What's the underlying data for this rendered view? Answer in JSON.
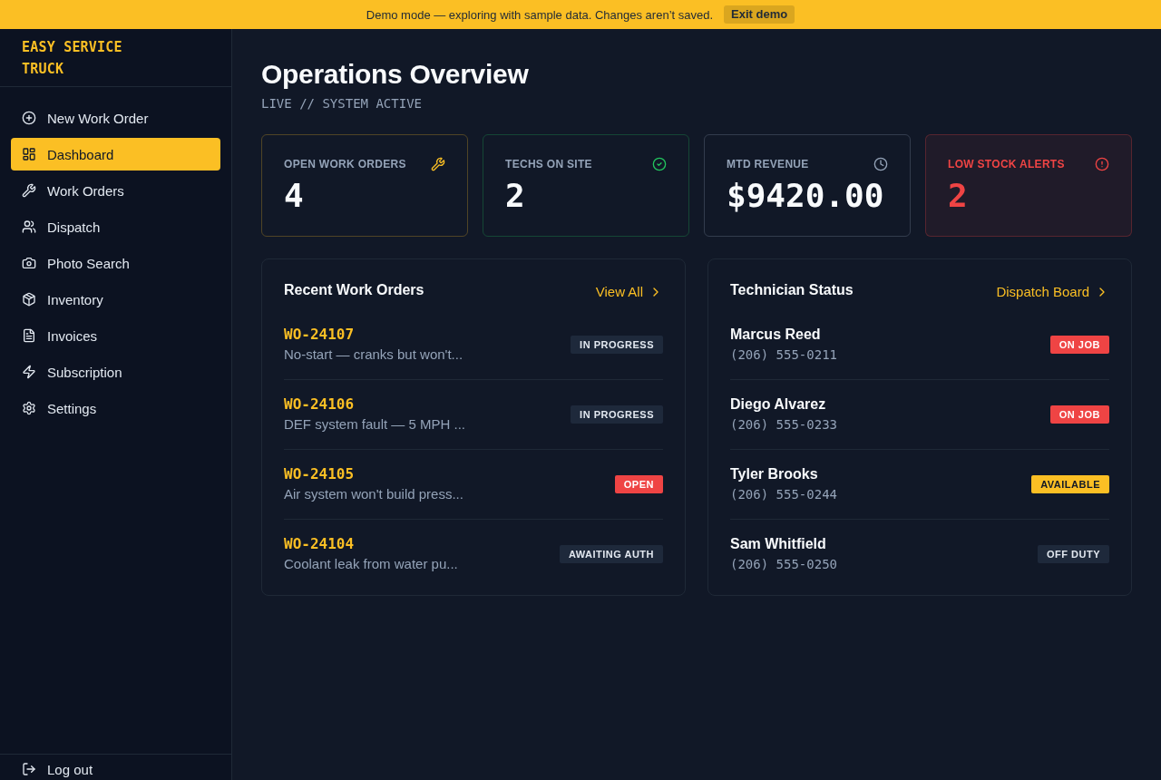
{
  "banner": {
    "message": "Demo mode — exploring with sample data. Changes aren’t saved.",
    "action": "Exit demo"
  },
  "sidebar": {
    "logo": "EASY SERVICE TRUCK",
    "items": [
      {
        "label": "New Work Order",
        "selected": false
      },
      {
        "label": "Dashboard",
        "selected": true
      },
      {
        "label": "Work Orders",
        "selected": false
      },
      {
        "label": "Dispatch",
        "selected": false
      },
      {
        "label": "Photo Search",
        "selected": false
      },
      {
        "label": "Inventory",
        "selected": false
      },
      {
        "label": "Invoices",
        "selected": false
      },
      {
        "label": "Subscription",
        "selected": false
      },
      {
        "label": "Settings",
        "selected": false
      }
    ],
    "footer": {
      "label": "Log out"
    }
  },
  "header": {
    "title": "Operations Overview",
    "subtitle": "LIVE // SYSTEM ACTIVE"
  },
  "stats": [
    {
      "label": "OPEN WORK ORDERS",
      "value": "4",
      "color": "#fbbf24",
      "alert": false
    },
    {
      "label": "TECHS ON SITE",
      "value": "2",
      "color": "#22c55e",
      "alert": false
    },
    {
      "label": "MTD REVENUE",
      "value": "$9420.00",
      "color": "#94a3b8",
      "alert": false
    },
    {
      "label": "LOW STOCK ALERTS",
      "value": "2",
      "color": "#ef4444",
      "alert": true
    }
  ],
  "recent_work_orders": {
    "title": "Recent Work Orders",
    "link": "View All",
    "rows": [
      {
        "id": "WO-24107",
        "description": "No-start — cranks but won't...",
        "status": {
          "label": "IN PROGRESS",
          "kind": "neutral"
        }
      },
      {
        "id": "WO-24106",
        "description": "DEF system fault — 5 MPH ...",
        "status": {
          "label": "IN PROGRESS",
          "kind": "neutral"
        }
      },
      {
        "id": "WO-24105",
        "description": "Air system won't build press...",
        "status": {
          "label": "OPEN",
          "kind": "danger"
        }
      },
      {
        "id": "WO-24104",
        "description": "Coolant leak from water pu...",
        "status": {
          "label": "AWAITING AUTH",
          "kind": "neutral"
        }
      }
    ]
  },
  "technician_status": {
    "title": "Technician Status",
    "link": "Dispatch Board",
    "rows": [
      {
        "name": "Marcus Reed",
        "phone": "(206) 555-0211",
        "status": {
          "label": "ON JOB",
          "kind": "danger"
        }
      },
      {
        "name": "Diego Alvarez",
        "phone": "(206) 555-0233",
        "status": {
          "label": "ON JOB",
          "kind": "danger"
        }
      },
      {
        "name": "Tyler Brooks",
        "phone": "(206) 555-0244",
        "status": {
          "label": "AVAILABLE",
          "kind": "warning"
        }
      },
      {
        "name": "Sam Whitfield",
        "phone": "(206) 555-0250",
        "status": {
          "label": "OFF DUTY",
          "kind": "neutral"
        }
      }
    ]
  }
}
